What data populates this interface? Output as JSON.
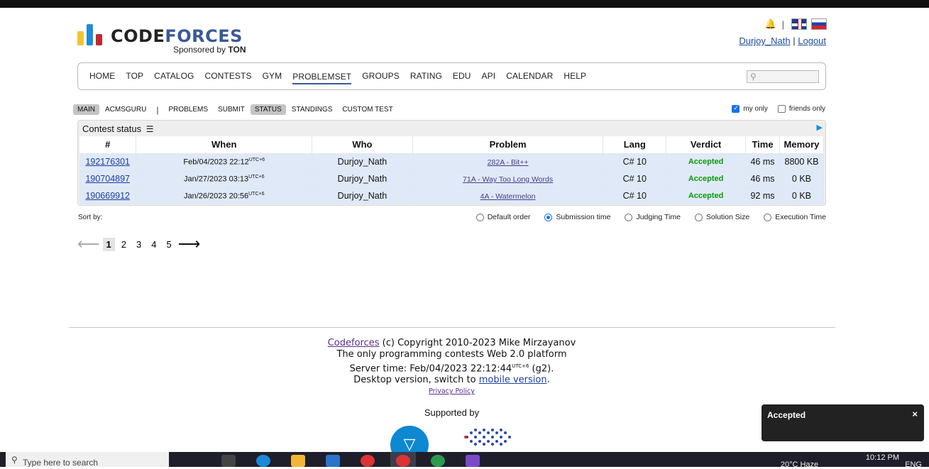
{
  "header": {
    "logo_a": "CODE",
    "logo_b": "FORCES",
    "sponsored_prefix": "Sponsored by ",
    "sponsor": "TON",
    "username": "Durjoy_Nath",
    "separator": "|",
    "logout": "Logout"
  },
  "menu": {
    "items": [
      "HOME",
      "TOP",
      "CATALOG",
      "CONTESTS",
      "GYM",
      "PROBLEMSET",
      "GROUPS",
      "RATING",
      "EDU",
      "API",
      "CALENDAR",
      "HELP"
    ],
    "active": "PROBLEMSET"
  },
  "submenu": {
    "items": [
      "MAIN",
      "ACMSGURU",
      "PROBLEMS",
      "SUBMIT",
      "STATUS",
      "STANDINGS",
      "CUSTOM TEST"
    ],
    "selected": [
      "MAIN",
      "STATUS"
    ],
    "divider": "|",
    "my_only": "my only",
    "friends_only": "friends only"
  },
  "status": {
    "title": "Contest status",
    "columns": [
      "#",
      "When",
      "Who",
      "Problem",
      "Lang",
      "Verdict",
      "Time",
      "Memory"
    ],
    "rows": [
      {
        "id": "192176301",
        "when": "Feb/04/2023 22:12",
        "tz": "UTC+6",
        "who": "Durjoy_Nath",
        "problem": "282A - Bit++",
        "lang": "C# 10",
        "verdict": "Accepted",
        "time": "46 ms",
        "memory": "8800 KB"
      },
      {
        "id": "190704897",
        "when": "Jan/27/2023 03:13",
        "tz": "UTC+6",
        "who": "Durjoy_Nath",
        "problem": "71A - Way Too Long Words",
        "lang": "C# 10",
        "verdict": "Accepted",
        "time": "46 ms",
        "memory": "0 KB"
      },
      {
        "id": "190669912",
        "when": "Jan/26/2023 20:56",
        "tz": "UTC+6",
        "who": "Durjoy_Nath",
        "problem": "4A - Watermelon",
        "lang": "C# 10",
        "verdict": "Accepted",
        "time": "92 ms",
        "memory": "0 KB"
      }
    ]
  },
  "sort": {
    "label": "Sort by:",
    "options": [
      "Default order",
      "Submission time",
      "Judging Time",
      "Solution Size",
      "Execution Time"
    ],
    "selected": "Submission time"
  },
  "pager": {
    "prev": "⟵",
    "next": "⟶",
    "pages": [
      "1",
      "2",
      "3",
      "4",
      "5"
    ],
    "current": "1"
  },
  "footer": {
    "site": "Codeforces",
    "copyright": " (c) Copyright 2010-2023 Mike Mirzayanov",
    "tagline": "The only programming contests Web 2.0 platform",
    "server_time_prefix": "Server time: Feb/04/2023 22:12:44",
    "server_tz": "UTC+6",
    "server_suffix": " (g2).",
    "desktop_prefix": "Desktop version, switch to ",
    "mobile": "mobile version",
    "desktop_suffix": ".",
    "privacy": "Privacy Policy",
    "supported": "Supported by"
  },
  "toast": {
    "text": "Accepted",
    "close": "×"
  },
  "taskbar": {
    "search_placeholder": "Type here to search",
    "weather": "20°C  Haze",
    "lang": "ENG",
    "time": "10:12 PM"
  },
  "colors": {
    "accent": "#3b5998",
    "accepted": "#0a9a0a",
    "row_bg": "#dfe9f7"
  }
}
